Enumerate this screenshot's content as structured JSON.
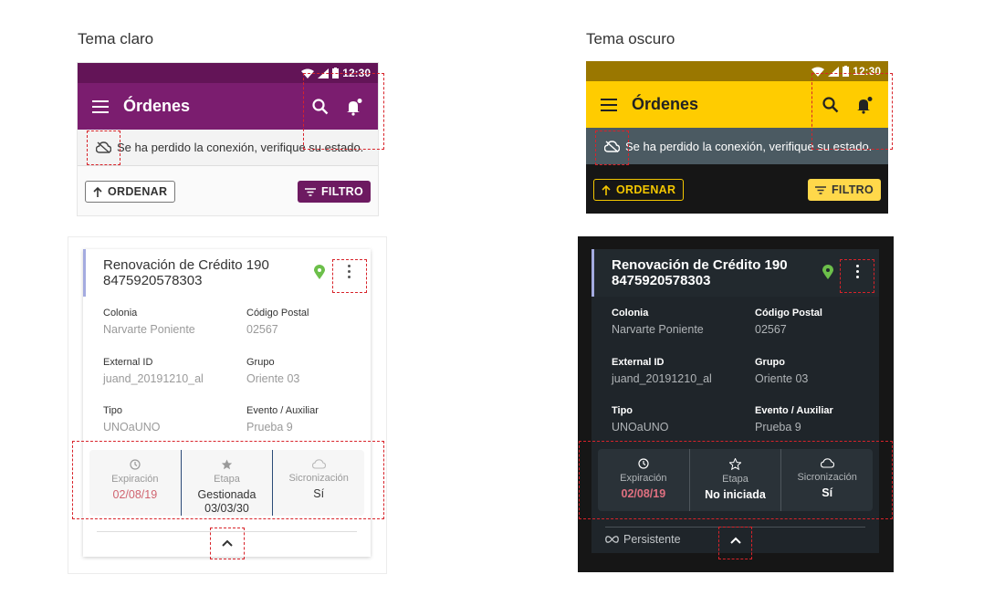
{
  "light": {
    "title": "Tema claro",
    "status_time": "12:30",
    "app_title": "Órdenes",
    "offline_text": "Se ha perdido la conexión, verifique su estado.",
    "order_label": "ORDENAR",
    "filter_label": "FILTRO",
    "card": {
      "title_line1": "Renovación de Crédito 190",
      "title_line2": "8475920578303",
      "fields": [
        {
          "label": "Colonia",
          "value": "Narvarte Poniente"
        },
        {
          "label": "Código Postal",
          "value": "02567"
        },
        {
          "label": "External ID",
          "value": "juand_20191210_al"
        },
        {
          "label": "Grupo",
          "value": "Oriente 03"
        },
        {
          "label": "Tipo",
          "value": "UNOaUNO"
        },
        {
          "label": "Evento / Auxiliar",
          "value": "Prueba 9"
        }
      ],
      "stats": [
        {
          "label": "Expiración",
          "value": "02/08/19"
        },
        {
          "label": "Etapa",
          "value": "Gestionada",
          "value2": "03/03/30"
        },
        {
          "label": "Sicronización",
          "value": "Sí"
        }
      ]
    }
  },
  "dark": {
    "title": "Tema oscuro",
    "status_time": "12:30",
    "app_title": "Órdenes",
    "offline_text": "Se ha perdido la conexión, verifique su estado.",
    "order_label": "ORDENAR",
    "filter_label": "FILTRO",
    "card": {
      "title_line1": "Renovación de Crédito 190",
      "title_line2": "8475920578303",
      "fields": [
        {
          "label": "Colonia",
          "value": "Narvarte Poniente"
        },
        {
          "label": "Código Postal",
          "value": "02567"
        },
        {
          "label": "External ID",
          "value": "juand_20191210_al"
        },
        {
          "label": "Grupo",
          "value": "Oriente 03"
        },
        {
          "label": "Tipo",
          "value": "UNOaUNO"
        },
        {
          "label": "Evento / Auxiliar",
          "value": "Prueba 9"
        }
      ],
      "stats": [
        {
          "label": "Expiración",
          "value": "02/08/19"
        },
        {
          "label": "Etapa",
          "value": "No iniciada"
        },
        {
          "label": "Sicronización",
          "value": "Sí"
        }
      ],
      "persist_label": "Persistente"
    }
  },
  "colors": {
    "light_primary": "#7b1d6f",
    "dark_primary": "#ffcc00",
    "expiration_red": "#d06470",
    "pin_green": "#6cbf4a",
    "annotation_red": "#d8232a"
  },
  "icons": [
    "wifi-icon",
    "signal-icon",
    "battery-icon",
    "menu-icon",
    "search-icon",
    "bell-icon",
    "cloud-off-icon",
    "arrow-up-icon",
    "filter-icon",
    "location-pin-icon",
    "more-vert-icon",
    "clock-icon",
    "star-icon",
    "cloud-icon",
    "chevron-up-icon",
    "infinity-icon"
  ]
}
